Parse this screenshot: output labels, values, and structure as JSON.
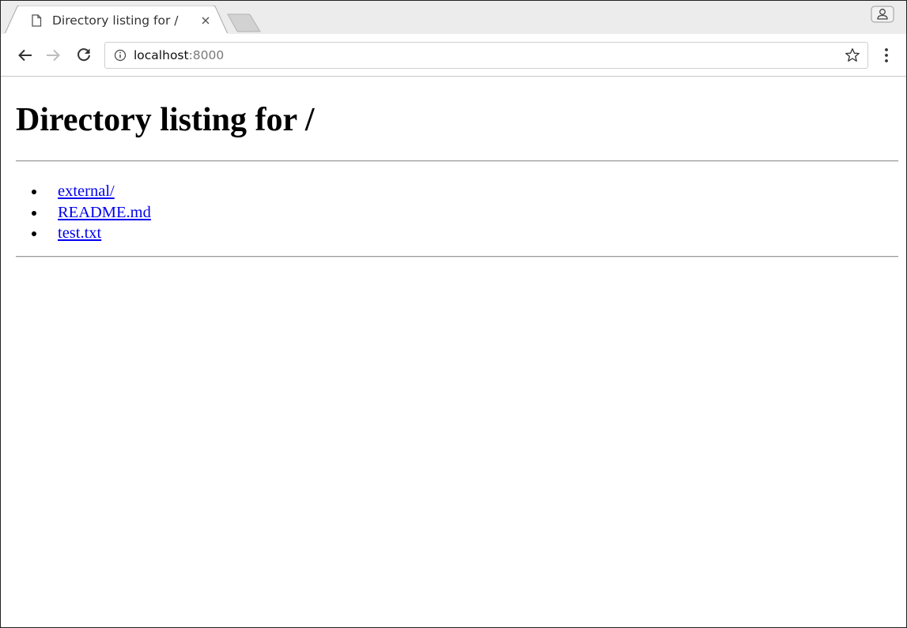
{
  "browser": {
    "tab": {
      "title": "Directory listing for /",
      "close_glyph": "×",
      "favicon": "page-icon"
    },
    "toolbar": {
      "back_icon": "back-arrow-icon",
      "forward_icon": "forward-arrow-icon",
      "reload_icon": "reload-icon",
      "url_host": "localhost",
      "url_port": ":8000",
      "info_icon": "info-icon",
      "bookmark_icon": "star-icon",
      "menu_icon": "kebab-menu-icon"
    },
    "profile_icon": "profile-icon"
  },
  "page": {
    "heading": "Directory listing for /",
    "entries": [
      {
        "name": "external/"
      },
      {
        "name": "README.md"
      },
      {
        "name": "test.txt"
      }
    ]
  },
  "colors": {
    "link": "#0000ee",
    "tabstrip": "#ececec",
    "hr": "#9a9a9a"
  }
}
